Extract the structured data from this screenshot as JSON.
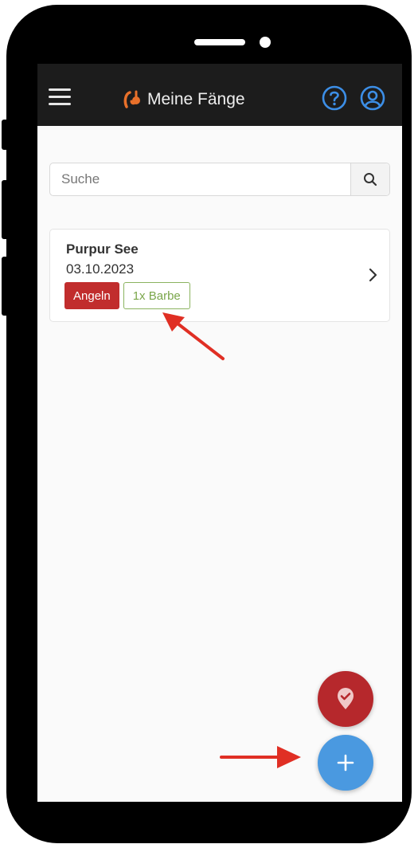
{
  "header": {
    "title": "Meine Fänge",
    "menu_icon": "hamburger-menu-icon",
    "logo_icon": "fishing-hook-icon",
    "help_icon": "help-question-icon",
    "profile_icon": "user-circle-icon"
  },
  "search": {
    "placeholder": "Suche",
    "value": "",
    "button_icon": "search-icon"
  },
  "catches": [
    {
      "location": "Purpur See",
      "date": "03.10.2023",
      "tags": [
        "Angeln",
        "1x Barbe"
      ]
    }
  ],
  "actions": {
    "check_icon": "map-pin-check-icon",
    "add_icon": "plus-icon"
  },
  "colors": {
    "header_bg": "#1c1c1c",
    "accent_orange": "#e8702a",
    "accent_blue": "#4a99e0",
    "tag_red": "#c12d2d",
    "tag_green": "#7aa64a",
    "annotation_arrow": "#e02f24"
  }
}
